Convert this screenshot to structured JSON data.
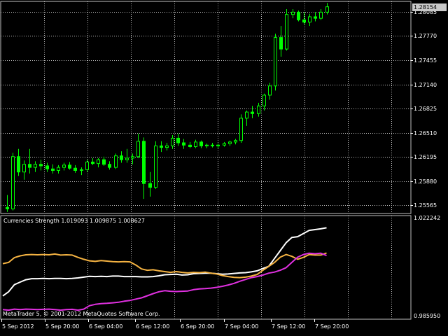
{
  "price_axis": {
    "labels": [
      "1.28085",
      "1.27770",
      "1.27455",
      "1.27140",
      "1.26825",
      "1.26510",
      "1.26195",
      "1.25880",
      "1.25565"
    ],
    "current_price": "1.28154"
  },
  "indicator": {
    "title": "Currencies Strength 1.019093 1.009875 1.008627",
    "axis_max": "1.022242",
    "axis_min": "0.985950"
  },
  "time_axis": {
    "labels": [
      "5 Sep 2012",
      "5 Sep 20:00",
      "6 Sep 04:00",
      "6 Sep 12:00",
      "6 Sep 20:00",
      "7 Sep 04:00",
      "7 Sep 12:00",
      "7 Sep 20:00"
    ]
  },
  "footer": {
    "copyright": "MetaTrader 5, © 2001-2012 MetaQuotes Software Corp."
  },
  "colors": {
    "background": "#000000",
    "candle": "#00ff00",
    "grid": "#c0c0c0",
    "series_white": "#ffffff",
    "series_orange": "#f5b342",
    "series_magenta": "#e030e0"
  },
  "chart_data": [
    {
      "type": "candlestick",
      "ylim": [
        1.2546,
        1.2822
      ],
      "candles": [
        [
          1.2554,
          1.257,
          1.2548,
          1.2552
        ],
        [
          1.2552,
          1.2625,
          1.255,
          1.262
        ],
        [
          1.262,
          1.263,
          1.2595,
          1.26
        ],
        [
          1.26,
          1.2615,
          1.259,
          1.261
        ],
        [
          1.261,
          1.263,
          1.2598,
          1.2606
        ],
        [
          1.2606,
          1.2614,
          1.26,
          1.261
        ],
        [
          1.261,
          1.2616,
          1.2602,
          1.2608
        ],
        [
          1.2608,
          1.2612,
          1.26,
          1.2604
        ],
        [
          1.2604,
          1.261,
          1.2598,
          1.2602
        ],
        [
          1.2602,
          1.2609,
          1.2598,
          1.2606
        ],
        [
          1.2606,
          1.2612,
          1.2602,
          1.2609
        ],
        [
          1.2609,
          1.2613,
          1.2603,
          1.2605
        ],
        [
          1.2605,
          1.2609,
          1.2599,
          1.2602
        ],
        [
          1.2602,
          1.2606,
          1.2596,
          1.2603
        ],
        [
          1.2603,
          1.2616,
          1.26,
          1.2613
        ],
        [
          1.2613,
          1.2618,
          1.2609,
          1.2611
        ],
        [
          1.2611,
          1.2618,
          1.2606,
          1.2616
        ],
        [
          1.2616,
          1.262,
          1.2608,
          1.261
        ],
        [
          1.261,
          1.2614,
          1.2603,
          1.2606
        ],
        [
          1.2606,
          1.2624,
          1.2604,
          1.2621
        ],
        [
          1.2621,
          1.2627,
          1.2612,
          1.2616
        ],
        [
          1.2616,
          1.263,
          1.2612,
          1.2618
        ],
        [
          1.2618,
          1.2624,
          1.261,
          1.262
        ],
        [
          1.262,
          1.265,
          1.2618,
          1.264
        ],
        [
          1.264,
          1.2645,
          1.2565,
          1.2585
        ],
        [
          1.2585,
          1.26,
          1.2568,
          1.258
        ],
        [
          1.258,
          1.264,
          1.2578,
          1.2634
        ],
        [
          1.2634,
          1.264,
          1.2626,
          1.2632
        ],
        [
          1.2632,
          1.2638,
          1.2628,
          1.2634
        ],
        [
          1.2634,
          1.2648,
          1.263,
          1.2644
        ],
        [
          1.2644,
          1.265,
          1.2634,
          1.2638
        ],
        [
          1.2638,
          1.2643,
          1.263,
          1.2635
        ],
        [
          1.2635,
          1.2639,
          1.2631,
          1.2633
        ],
        [
          1.2633,
          1.2642,
          1.2631,
          1.2639
        ],
        [
          1.2639,
          1.2641,
          1.2631,
          1.2634
        ],
        [
          1.2634,
          1.2637,
          1.2631,
          1.2635
        ],
        [
          1.2635,
          1.2638,
          1.2632,
          1.2634
        ],
        [
          1.2634,
          1.2637,
          1.2631,
          1.2635
        ],
        [
          1.2635,
          1.2639,
          1.2633,
          1.2637
        ],
        [
          1.2637,
          1.2641,
          1.2634,
          1.2639
        ],
        [
          1.2639,
          1.2643,
          1.2636,
          1.2641
        ],
        [
          1.2641,
          1.2675,
          1.2638,
          1.267
        ],
        [
          1.267,
          1.268,
          1.266,
          1.2678
        ],
        [
          1.2678,
          1.2686,
          1.267,
          1.2676
        ],
        [
          1.2676,
          1.269,
          1.2672,
          1.2686
        ],
        [
          1.2686,
          1.2702,
          1.268,
          1.27
        ],
        [
          1.27,
          1.2716,
          1.2694,
          1.2712
        ],
        [
          1.2712,
          1.278,
          1.2706,
          1.2775
        ],
        [
          1.2775,
          1.279,
          1.275,
          1.276
        ],
        [
          1.276,
          1.2812,
          1.2758,
          1.2805
        ],
        [
          1.2805,
          1.2812,
          1.28,
          1.2808
        ],
        [
          1.2808,
          1.281,
          1.2796,
          1.2798
        ],
        [
          1.2798,
          1.2808,
          1.2792,
          1.2795
        ],
        [
          1.2795,
          1.2806,
          1.279,
          1.2802
        ],
        [
          1.2802,
          1.2808,
          1.2796,
          1.28
        ],
        [
          1.28,
          1.2812,
          1.2798,
          1.2808
        ],
        [
          1.2808,
          1.282,
          1.2805,
          1.2815
        ]
      ]
    },
    {
      "type": "line",
      "title": "Currencies Strength 1.019093 1.009875 1.008627",
      "ylim": [
        0.98595,
        1.022242
      ],
      "series": [
        {
          "color": "#ffffff",
          "values": [
            0.9932,
            0.9948,
            0.9975,
            0.9985,
            0.9994,
            0.9998,
            0.9998,
            0.9999,
            0.9998,
            0.9999,
            0.9999,
            0.9998,
            0.9999,
            1.0001,
            1.0004,
            1.0007,
            1.0006,
            1.0007,
            1.0006,
            1.0008,
            1.0008,
            1.0006,
            1.0006,
            1.0006,
            1.0005,
            1.0005,
            1.0006,
            1.0009,
            1.0013,
            1.0014,
            1.0015,
            1.0012,
            1.0013,
            1.0017,
            1.0018,
            1.0019,
            1.0019,
            1.0017,
            1.0015,
            1.0016,
            1.0018,
            1.002,
            1.0021,
            1.0024,
            1.0028,
            1.0037,
            1.0045,
            1.0075,
            1.0105,
            1.0135,
            1.0155,
            1.0158,
            1.017,
            1.0182,
            1.0185,
            1.0188,
            1.0192
          ]
        },
        {
          "color": "#f5b342",
          "values": [
            1.0055,
            1.006,
            1.0078,
            1.0085,
            1.0089,
            1.009,
            1.0089,
            1.009,
            1.0089,
            1.0092,
            1.0088,
            1.0089,
            1.0088,
            1.0079,
            1.0072,
            1.0066,
            1.0064,
            1.0067,
            1.0065,
            1.0063,
            1.0062,
            1.0063,
            1.0062,
            1.005,
            1.0035,
            1.003,
            1.0032,
            1.0028,
            1.0025,
            1.0022,
            1.0025,
            1.0022,
            1.002,
            1.0022,
            1.0021,
            1.0023,
            1.0019,
            1.0016,
            1.001,
            1.0006,
            1.0003,
            1.0002,
            1.0004,
            1.0008,
            1.0014,
            1.003,
            1.0045,
            1.006,
            1.008,
            1.009,
            1.0083,
            1.0072,
            1.0079,
            1.009,
            1.0088,
            1.0088,
            1.0096
          ]
        },
        {
          "color": "#e030e0",
          "values": [
            0.988,
            0.9878,
            0.9882,
            0.988,
            0.9882,
            0.9881,
            0.988,
            0.9881,
            0.9882,
            0.988,
            0.9878,
            0.988,
            0.9881,
            0.9878,
            0.9882,
            0.9895,
            0.99,
            0.9903,
            0.9904,
            0.9906,
            0.9908,
            0.9912,
            0.9915,
            0.992,
            0.9925,
            0.9933,
            0.9941,
            0.9948,
            0.9952,
            0.995,
            0.9949,
            0.995,
            0.9951,
            0.9956,
            0.9959,
            0.996,
            0.9962,
            0.9965,
            0.9969,
            0.9974,
            0.998,
            0.9988,
            0.9995,
            1.0002,
            1.0006,
            1.0012,
            1.0019,
            1.0023,
            1.003,
            1.004,
            1.006,
            1.008,
            1.009,
            1.0095,
            1.0093,
            1.0095,
            1.0086
          ]
        }
      ]
    }
  ]
}
